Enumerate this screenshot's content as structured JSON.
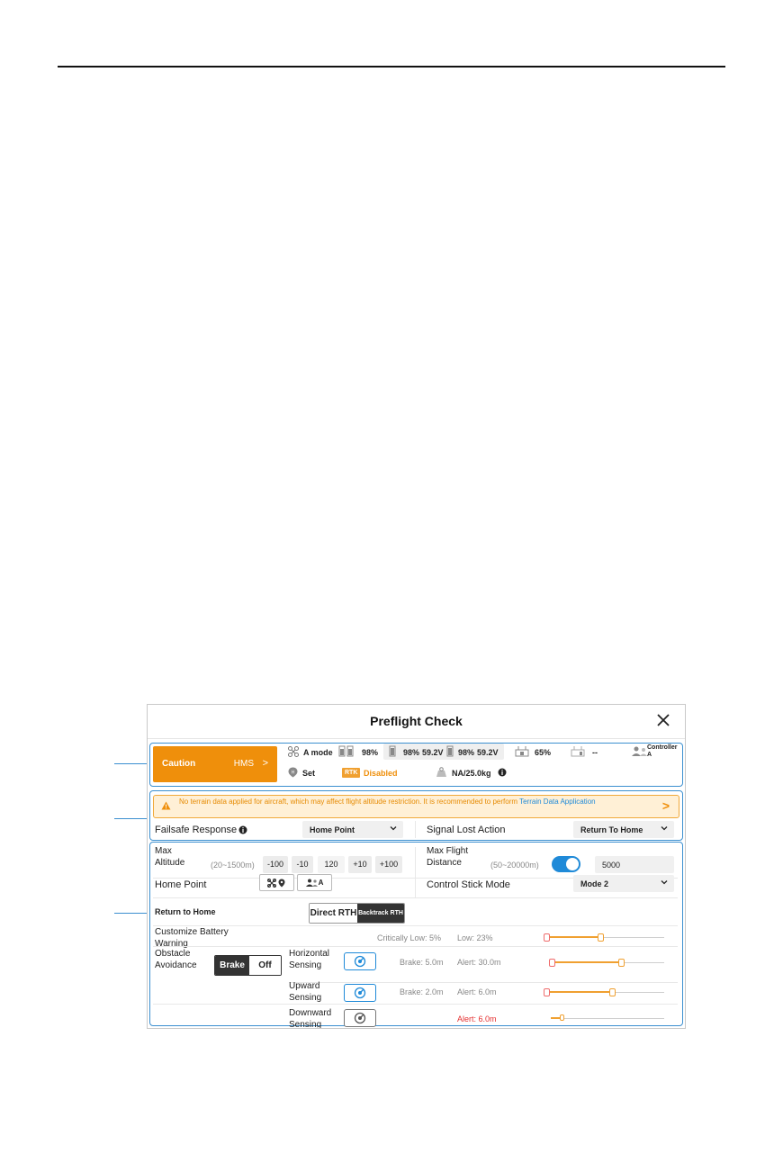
{
  "dialog": {
    "title": "Preflight Check",
    "close_icon": "close-icon"
  },
  "status": {
    "caution_label": "Caution",
    "hms_label": "HMS",
    "hms_chevron": ">",
    "flight_mode": "A mode",
    "battery_total": "98%",
    "battery1_pct": "98%",
    "battery1_volt": "59.2V",
    "battery2_pct": "98%",
    "battery2_volt": "59.2V",
    "rc_battery": "65%",
    "rc2_battery": "--",
    "controller_label": "Controller A",
    "home_point_status": "Set",
    "rtk_badge": "RTK",
    "rtk_status": "Disabled",
    "payload": "NA/25.0kg"
  },
  "warning": {
    "text": "No terrain data applied for aircraft, which may affect flight altitude restriction. It is recommended to perform ",
    "link": "Terrain Data Application",
    "chevron": ">"
  },
  "failsafe": {
    "label": "Failsafe Response",
    "value": "Home Point"
  },
  "signal_lost": {
    "label": "Signal Lost Action",
    "value": "Return To Home"
  },
  "max_altitude": {
    "label": "Max Altitude",
    "range": "(20~1500m)",
    "buttons": [
      "-100",
      "-10",
      "120",
      "+10",
      "+100"
    ]
  },
  "max_distance": {
    "label": "Max Flight Distance",
    "range": "(50~20000m)",
    "enabled": true,
    "value": "5000"
  },
  "home_point": {
    "label": "Home Point",
    "controller_btn": "A"
  },
  "stick_mode": {
    "label": "Control Stick Mode",
    "value": "Mode 2"
  },
  "rth": {
    "label": "Return to Home",
    "options": [
      "Direct RTH",
      "Backtrack RTH"
    ],
    "selected": "Backtrack RTH"
  },
  "battery_warning": {
    "label": "Customize Battery Warning",
    "critical": "Critically Low:  5%",
    "low": "Low: 23%",
    "critical_value": 5,
    "low_value": 23
  },
  "obstacle": {
    "label": "Obstacle Avoidance",
    "options": [
      "Brake",
      "Off"
    ],
    "selected": "Brake",
    "rows": [
      {
        "label": "Horizontal Sensing",
        "brake": "Brake: 5.0m",
        "alert": "Alert: 30.0m",
        "brake_fraction": 0.05,
        "alert_fraction": 0.63
      },
      {
        "label": "Upward Sensing",
        "brake": "Brake: 2.0m",
        "alert": "Alert: 6.0m",
        "brake_fraction": 0.0,
        "alert_fraction": 0.55
      },
      {
        "label": "Downward Sensing",
        "brake": "",
        "alert": "Alert: 6.0m",
        "brake_fraction": 0.0,
        "alert_fraction": 0.1
      }
    ]
  },
  "colors": {
    "accent": "#1f8ad8",
    "caution": "#ef8f0b",
    "warning_text": "#e68a00",
    "alert_red": "#e53030"
  }
}
